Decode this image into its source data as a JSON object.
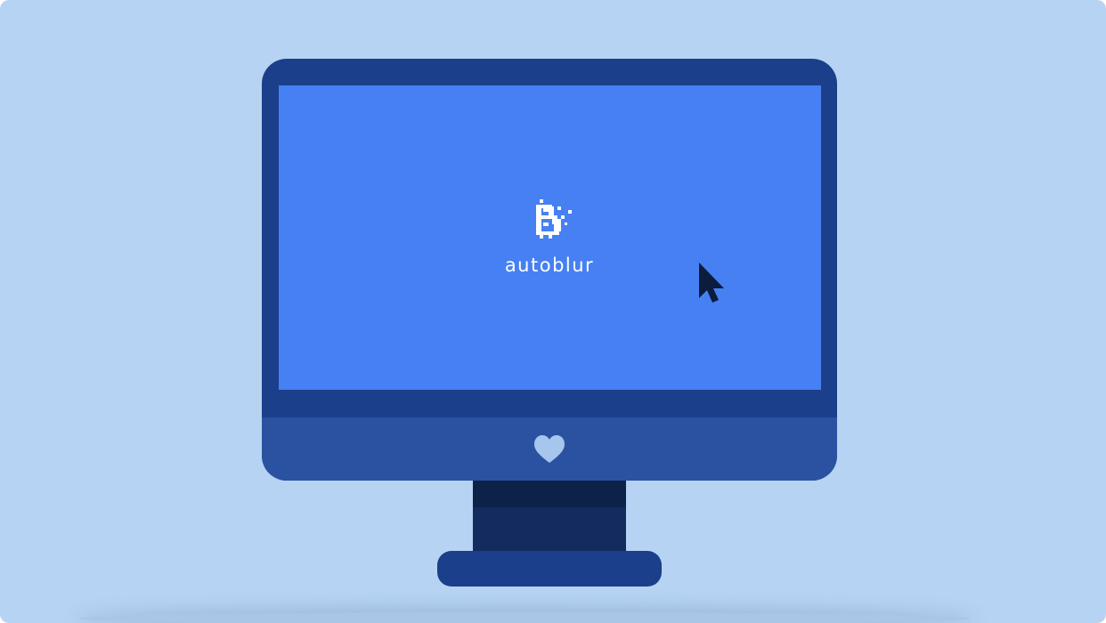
{
  "app": {
    "name": "autoblur",
    "logo_icon": "pixelated-b-logo-icon"
  },
  "screen": {
    "cursor_icon": "mouse-pointer-icon"
  },
  "monitor": {
    "chin_icon": "heart-icon"
  },
  "colors": {
    "background": "#b6d3f3",
    "monitor_frame": "#1b3f8a",
    "screen": "#4680f3",
    "chin": "#2b52a1",
    "stand": "#132b5e",
    "heart": "#a7c6ee",
    "cursor": "#0b1c3c",
    "text": "#ffffff"
  }
}
